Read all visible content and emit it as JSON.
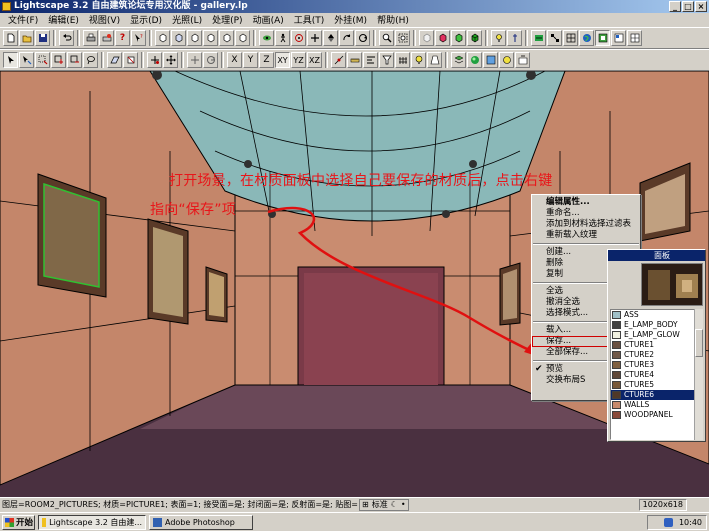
{
  "window": {
    "title": "Lightscape 3.2 自由建筑论坛专用汉化版 - gallery.lp",
    "buttons": {
      "minimize": "_",
      "maximize": "□",
      "close": "×"
    }
  },
  "menu": [
    "文件(F)",
    "编辑(E)",
    "视图(V)",
    "显示(D)",
    "光照(L)",
    "处理(P)",
    "动画(A)",
    "工具(T)",
    "外挂(M)",
    "帮助(H)"
  ],
  "toolbar2_labels": {
    "x": "X",
    "y": "Y",
    "z": "Z",
    "xy": "XY",
    "yz": "YZ",
    "xz": "XZ"
  },
  "annotation": {
    "line1": "打开场景，在材质面板中选择自己要保存的材质后，点击右键",
    "line2": "指向“保存”项",
    "color": "#e8161a"
  },
  "context_menu": {
    "group1": [
      "编辑属性...",
      "重命名...",
      "添加到材料选择过滤表",
      "重新载入纹理"
    ],
    "group2": [
      "创建...",
      "删除",
      "复制"
    ],
    "group3": [
      "全选",
      "撤消全选",
      "选择模式..."
    ],
    "group4": [
      "载入...",
      "保存...",
      "全部保存..."
    ],
    "group5": [
      "预览",
      "交换布局S"
    ],
    "highlighted": "保存..."
  },
  "material_panel": {
    "title": "面板",
    "items": [
      {
        "name": "ASS",
        "color": "#a0c0c8"
      },
      {
        "name": "E_LAMP_BODY",
        "color": "#404040"
      },
      {
        "name": "E_LAMP_GLOW",
        "color": "#f0f0e0"
      },
      {
        "name": "CTURE1",
        "color": "#6a5040"
      },
      {
        "name": "CTURE2",
        "color": "#705848"
      },
      {
        "name": "CTURE3",
        "color": "#806040"
      },
      {
        "name": "CTURE4",
        "color": "#604838"
      },
      {
        "name": "CTURE5",
        "color": "#785838"
      },
      {
        "name": "CTURE6",
        "color": "#503828"
      },
      {
        "name": "WALLS",
        "color": "#c88a6c"
      },
      {
        "name": "WOODPANEL",
        "color": "#8a4a3a"
      }
    ],
    "selected_index": 8
  },
  "status": {
    "text": "图层=ROOM2_PICTURES; 材质=PICTURE1; 表面=1; 接受面=是; 封闭面=是; 反射面=是; 贴图=",
    "ime_mode": "标准",
    "dimensions": "1020x618"
  },
  "taskbar": {
    "start": "开始",
    "tasks": [
      "Lightscape 3.2 自由建...",
      "Adobe Photoshop"
    ],
    "clock": "10:40"
  }
}
